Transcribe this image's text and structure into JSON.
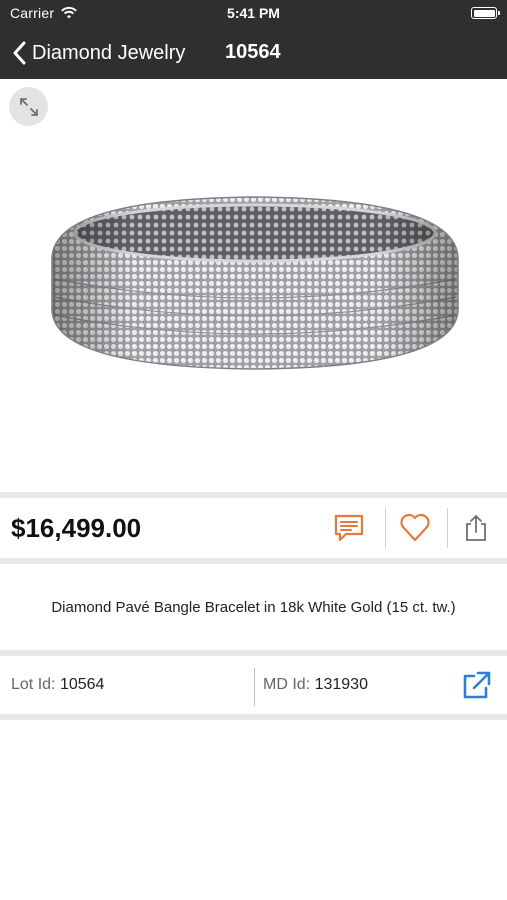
{
  "status_bar": {
    "carrier": "Carrier",
    "time": "5:41 PM"
  },
  "nav": {
    "back_label": "Diamond Jewelry",
    "title": "10564"
  },
  "product": {
    "image_alt": "Diamond Pavé Bangle Bracelet",
    "price": "$16,499.00",
    "description": "Diamond Pavé Bangle Bracelet in 18k White Gold (15 ct. tw.)"
  },
  "ids": {
    "lot_label": "Lot Id:",
    "lot_value": "10564",
    "md_label": "MD Id:",
    "md_value": "131930"
  },
  "icons": {
    "message": "message-icon",
    "favorite": "heart-icon",
    "share": "share-icon",
    "expand": "expand-icon",
    "external": "external-link-icon"
  },
  "colors": {
    "nav_bg": "#2f2f2f",
    "accent": "#e8783a",
    "link": "#2f7fd8",
    "divider": "#e8e8ec"
  }
}
